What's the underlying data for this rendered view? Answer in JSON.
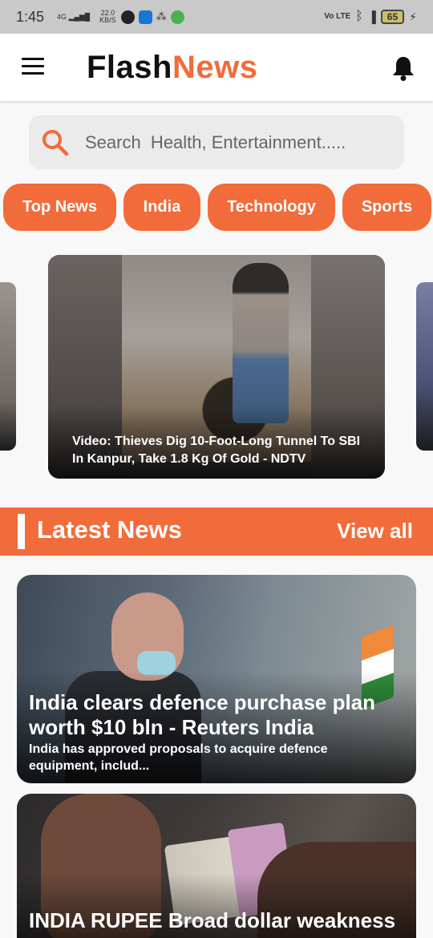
{
  "status_bar": {
    "time": "1:45",
    "network": "4G",
    "speed_value": "22.0",
    "speed_unit": "KB/S",
    "volte": "Vo LTE",
    "battery": "65"
  },
  "app_bar": {
    "brand_part1": "Flash",
    "brand_part2": "News",
    "menu_icon": "hamburger-menu-icon",
    "notification_icon": "bell-icon"
  },
  "search": {
    "placeholder": "Search  Health, Entertainment....."
  },
  "categories": [
    {
      "label": "Top News"
    },
    {
      "label": "India"
    },
    {
      "label": "Technology"
    },
    {
      "label": "Sports"
    }
  ],
  "carousel": {
    "featured_caption": "Video: Thieves Dig 10-Foot-Long Tunnel To SBI In Kanpur, Take 1.8 Kg Of Gold - NDTV"
  },
  "latest_section": {
    "title": "Latest News",
    "view_all": "View all"
  },
  "latest_news": [
    {
      "headline": "India clears defence purchase plan worth $10 bln - Reuters India",
      "description": "India has approved proposals to acquire defence equipment, includ..."
    },
    {
      "headline": "INDIA RUPEE Broad dollar weakness"
    }
  ],
  "colors": {
    "accent": "#f26b3a",
    "status_bar": "#c9c9c9",
    "background": "#f8f8f8"
  }
}
